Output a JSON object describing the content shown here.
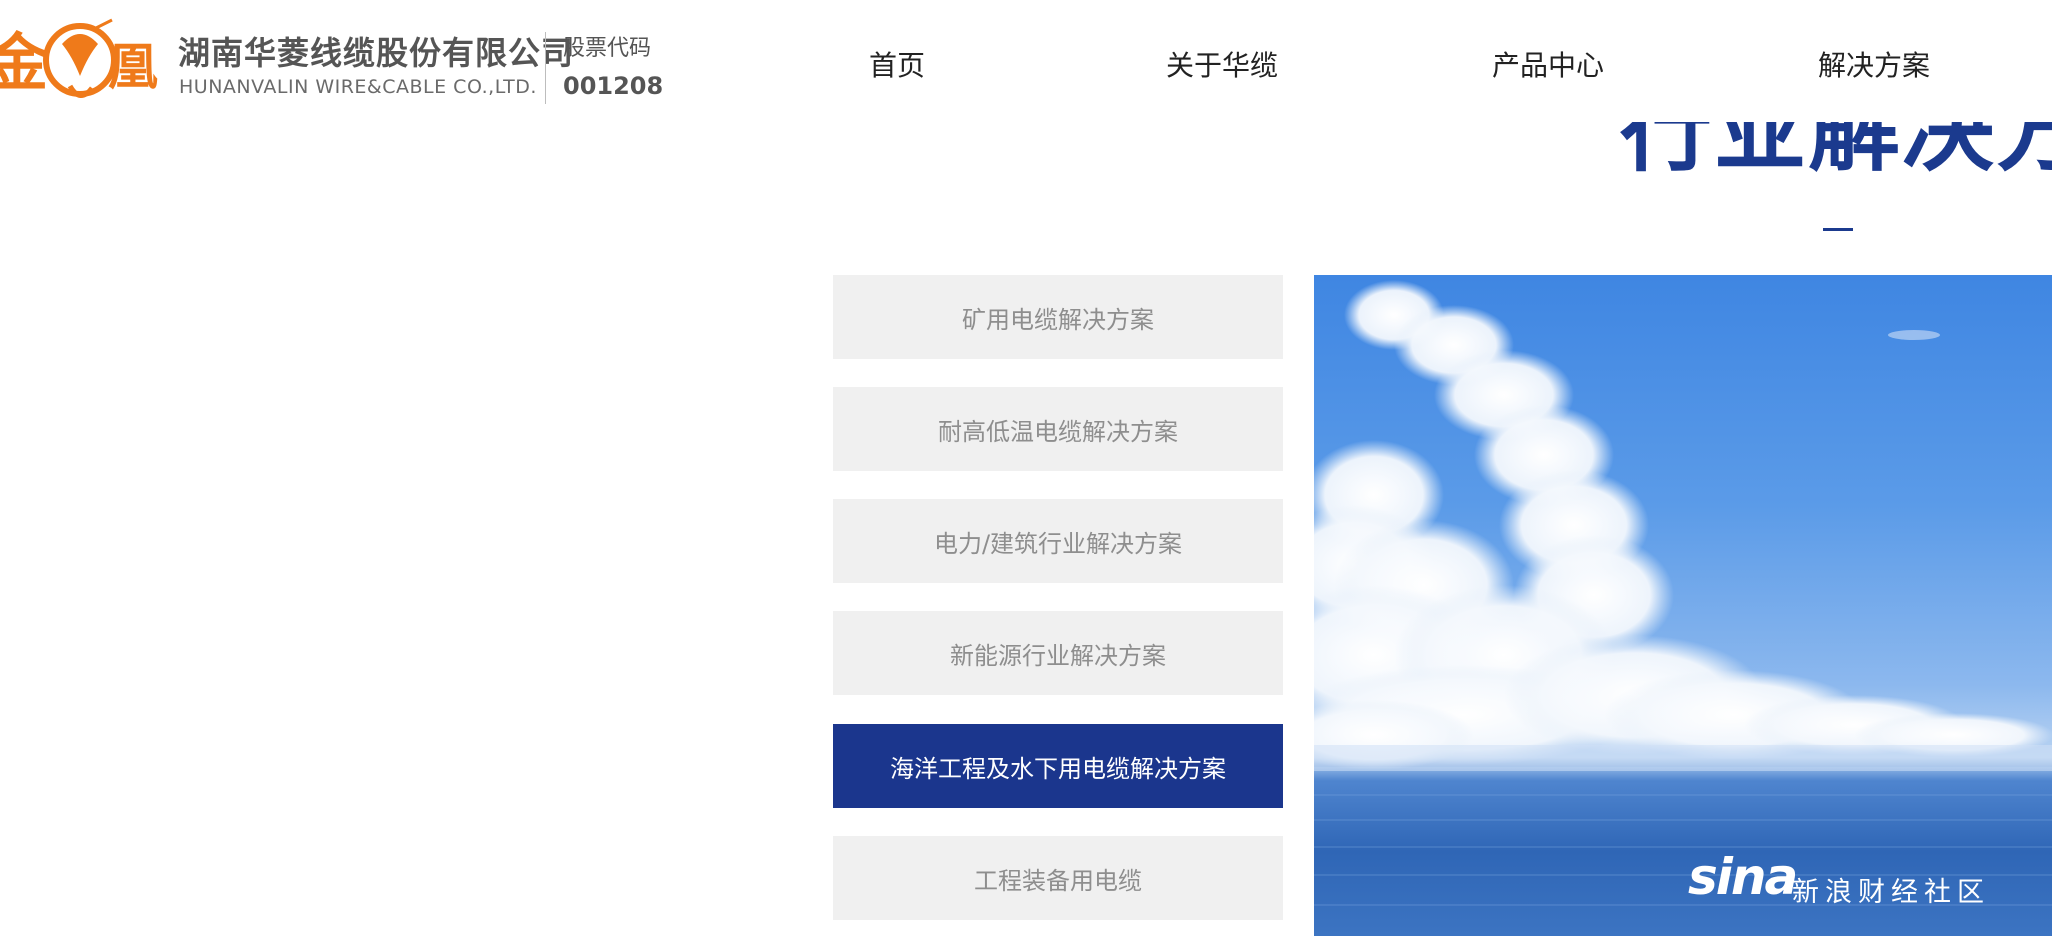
{
  "header": {
    "company_cn": "湖南华菱线缆股份有限公司",
    "company_en": "HUNANVALIN WIRE&CABLE CO.,LTD.",
    "stock_label": "股票代码",
    "stock_code": "001208",
    "logo_icon": "golden-phoenix-logo",
    "brand_color": "#ef7a1a"
  },
  "nav": {
    "items": [
      {
        "label": "首页"
      },
      {
        "label": "关于华缆"
      },
      {
        "label": "产品中心"
      },
      {
        "label": "解决方案"
      }
    ]
  },
  "section": {
    "title": "行业解决方案",
    "accent_color": "#1b3a8e"
  },
  "solutions": {
    "items": [
      {
        "label": "矿用电缆解决方案",
        "active": false
      },
      {
        "label": "耐高低温电缆解决方案",
        "active": false
      },
      {
        "label": "电力/建筑行业解决方案",
        "active": false
      },
      {
        "label": "新能源行业解决方案",
        "active": false
      },
      {
        "label": "海洋工程及水下用电缆解决方案",
        "active": true
      },
      {
        "label": "工程装备用电缆",
        "active": false
      }
    ],
    "active_color": "#1b368d",
    "inactive_bg": "#f0f0f0"
  },
  "hero": {
    "subject": "sky-and-ocean"
  },
  "watermark": {
    "brand": "sina",
    "text": "新浪财经社区"
  }
}
